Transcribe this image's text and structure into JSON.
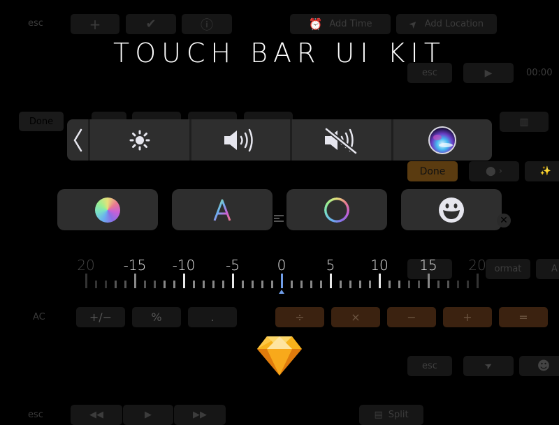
{
  "title": "TOUCH BAR UI KIT",
  "background_row1": {
    "esc": "esc",
    "buttons": [
      {
        "icon": "plus-icon",
        "glyph": "+"
      },
      {
        "icon": "checkmark-icon",
        "glyph": "✔"
      },
      {
        "icon": "info-icon",
        "glyph": "ⓘ"
      }
    ],
    "add_time": "Add Time",
    "add_location": "Add Location"
  },
  "background_row2": {
    "esc": "esc",
    "play": "▶",
    "time": "00:00"
  },
  "background_row3": {
    "done_left": "Done",
    "scale_labels": [
      "-15",
      "-10",
      "-5",
      "0",
      "5",
      "10",
      "15"
    ],
    "done_right": "Done"
  },
  "control_strip": {
    "back_glyph": "❮",
    "items": [
      {
        "name": "brightness",
        "icon": "brightness-icon"
      },
      {
        "name": "volume",
        "icon": "volume-icon"
      },
      {
        "name": "mute",
        "icon": "mute-icon"
      },
      {
        "name": "siri",
        "icon": "siri-icon"
      }
    ]
  },
  "tools": [
    {
      "name": "color-picker",
      "icon": "color-wheel-icon"
    },
    {
      "name": "text-style",
      "icon": "text-color-icon",
      "glyph": "A"
    },
    {
      "name": "stroke",
      "icon": "color-ring-icon"
    },
    {
      "name": "emoji",
      "icon": "emoji-icon"
    }
  ],
  "scrubber": {
    "labels": [
      "20",
      "-15",
      "-10",
      "-5",
      "0",
      "5",
      "10",
      "15",
      "20"
    ],
    "min": -20,
    "max": 20,
    "selected_value": 0,
    "accent": "#6f9de8"
  },
  "background_format": {
    "label": "ormat",
    "partial": "A"
  },
  "calculator": {
    "ac": "AC",
    "left_keys": [
      "+/−",
      "%",
      "."
    ],
    "operators": [
      "÷",
      "×",
      "−",
      "+",
      "="
    ],
    "operator_color": "#3b2210"
  },
  "background_bottom": {
    "esc": "esc",
    "send_glyph": "➤",
    "emoji_glyph": "☻",
    "esc2": "esc",
    "media": [
      "◀◀",
      "▶",
      "▶▶"
    ],
    "split": "Split"
  },
  "logo": "sketch-logo"
}
